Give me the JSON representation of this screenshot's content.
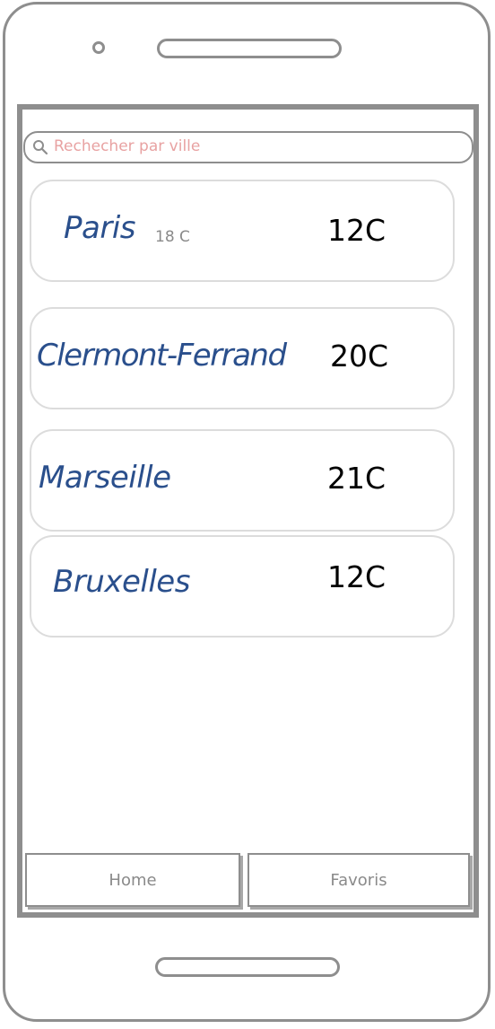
{
  "search": {
    "placeholder": "Rechecher par ville",
    "icon": "search-icon"
  },
  "cities": [
    {
      "name": "Paris",
      "secondary_temp": "18 C",
      "temperature": "12C"
    },
    {
      "name": "Clermont-Ferrand",
      "temperature": "20C"
    },
    {
      "name": "Marseille",
      "temperature": "21C"
    },
    {
      "name": "Bruxelles",
      "temperature": "12C"
    }
  ],
  "tabs": {
    "home": "Home",
    "favorites": "Favoris"
  },
  "colors": {
    "city_name": "#2a4f8c",
    "placeholder": "#e8a2a2",
    "frame": "#8e8e8e",
    "card_border": "#dcdcdc"
  }
}
